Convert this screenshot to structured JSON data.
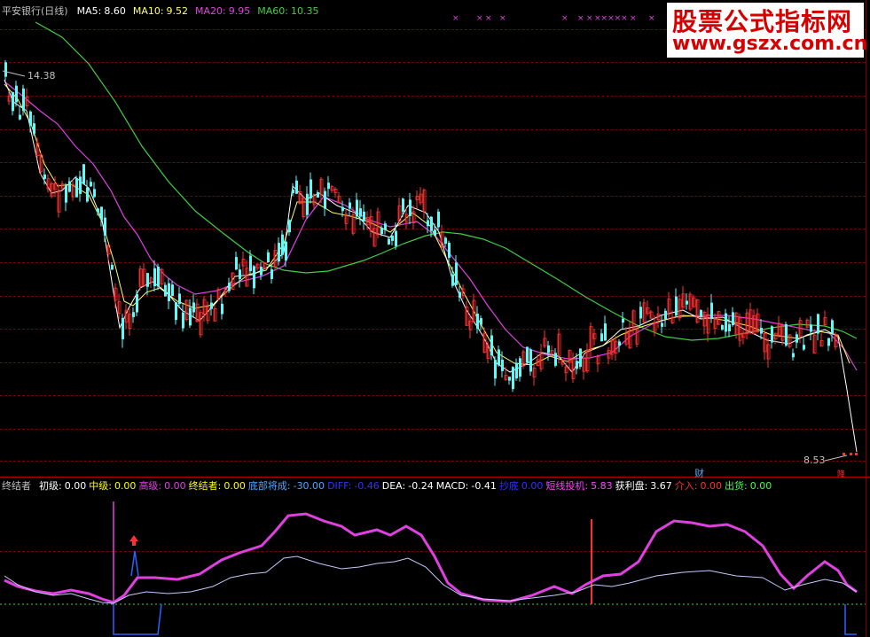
{
  "header": {
    "stock_name": "平安银行(日线)",
    "ma": [
      {
        "label": "MA5:",
        "value": "8.60",
        "color": "#ffffff"
      },
      {
        "label": "MA10:",
        "value": "9.52",
        "color": "#ffff66"
      },
      {
        "label": "MA20:",
        "value": "9.95",
        "color": "#e040e0"
      },
      {
        "label": "MA60:",
        "value": "10.35",
        "color": "#40d040"
      }
    ]
  },
  "price_labels": {
    "high": "14.38",
    "low": "8.53"
  },
  "markers": {
    "cai": "财",
    "jiang": "降"
  },
  "indicator": {
    "name": "终结者",
    "items": [
      {
        "label": "初级:",
        "value": "0.00",
        "color": "#ffffff"
      },
      {
        "label": "中级:",
        "value": "0.00",
        "color": "#ffff00"
      },
      {
        "label": "高级:",
        "value": "0.00",
        "color": "#e040e0"
      },
      {
        "label": "终结者:",
        "value": "0.00",
        "color": "#ffff00"
      },
      {
        "label": "底部将成:",
        "value": "-30.00",
        "color": "#4aa8ff"
      },
      {
        "label": "DIFF:",
        "value": "-0.46",
        "color": "#3030ff"
      },
      {
        "label": "DEA:",
        "value": "-0.24",
        "color": "#ffffff"
      },
      {
        "label": "MACD:",
        "value": "-0.41",
        "color": "#ffffff"
      },
      {
        "label": "抄底",
        "value": "0.00",
        "color": "#3030ff"
      },
      {
        "label": "短线投机:",
        "value": "5.83",
        "color": "#ff40ff"
      },
      {
        "label": "获利盘:",
        "value": "3.67",
        "color": "#ffffff"
      },
      {
        "label": "介入:",
        "value": "0.00",
        "color": "#ff3030"
      },
      {
        "label": "出货:",
        "value": "0.00",
        "color": "#40ff40"
      }
    ]
  },
  "watermark": {
    "title": "股票公式指标网",
    "url": "www.gszx.com.cn"
  },
  "colors": {
    "up": "#ff3232",
    "down": "#54ffff",
    "ma5": "#ffffff",
    "ma10": "#ffff66",
    "ma20": "#e040e0",
    "ma60": "#40d040"
  }
}
